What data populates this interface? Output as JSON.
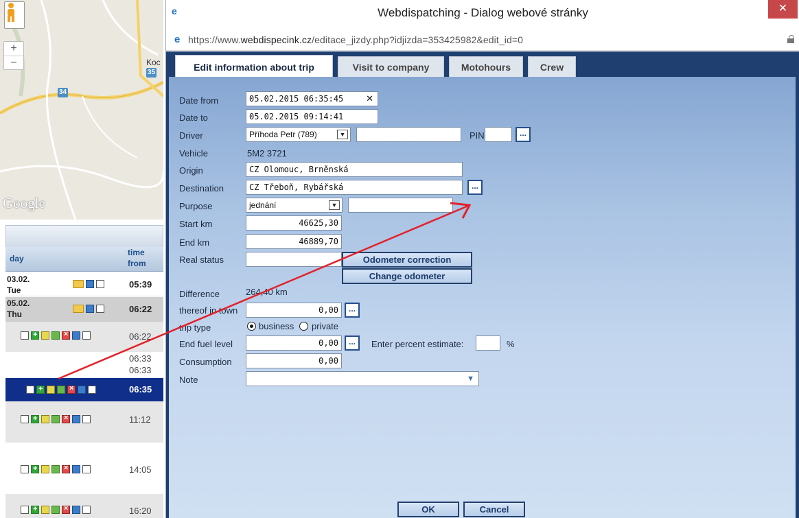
{
  "map": {
    "town_label": "Koc",
    "road_34": "34",
    "road_35": "35",
    "logo": "Google",
    "zoom_in": "+",
    "zoom_out": "−"
  },
  "day_list": {
    "col_day": "day",
    "col_time": "time from",
    "rows": [
      {
        "day": "03.02.",
        "weekday": "Tue",
        "time": "05:39"
      },
      {
        "day": "05.02.",
        "weekday": "Thu",
        "time": "06:22"
      },
      {
        "time": "06:22"
      },
      {
        "time": "06:33"
      },
      {
        "time": "06:33"
      },
      {
        "time": "06:35"
      },
      {
        "time": "11:12"
      },
      {
        "time": "14:05"
      },
      {
        "time": "16:20"
      }
    ]
  },
  "window": {
    "title": "Webdispatching - Dialog webové stránky",
    "close": "✕",
    "url_prefix": "https://www.",
    "url_domain": "webdispecink.cz",
    "url_rest": "/editace_jizdy.php?idjizda=353425982&edit_id=0"
  },
  "tabs": [
    {
      "label": "Edit information about trip",
      "active": true
    },
    {
      "label": "Visit to company",
      "active": false
    },
    {
      "label": "Motohours",
      "active": false
    },
    {
      "label": "Crew",
      "active": false
    }
  ],
  "form": {
    "date_from_label": "Date from",
    "date_from": "05.02.2015 06:35:45",
    "clear_icon": "✕",
    "date_to_label": "Date to",
    "date_to": "05.02.2015 09:14:41",
    "driver_label": "Driver",
    "driver": "Příhoda Petr (789)",
    "driver_extra": "",
    "pin_label": "PIN",
    "pin": "",
    "vehicle_label": "Vehicle",
    "vehicle": "5M2 3721",
    "origin_label": "Origin",
    "origin": "CZ Olomouc, Brněnská",
    "destination_label": "Destination",
    "destination": "CZ Třeboň, Rybářská",
    "purpose_label": "Purpose",
    "purpose": "jednání",
    "purpose_extra": "",
    "start_km_label": "Start km",
    "start_km": "46625,30",
    "end_km_label": "End km",
    "end_km": "46889,70",
    "real_status_label": "Real status",
    "real_status": "",
    "odometer_correction": "Odometer correction",
    "change_odometer": "Change odometer",
    "difference_label": "Difference",
    "difference": "264,40 km",
    "in_town_label": "thereof in town",
    "in_town": "0,00",
    "trip_type_label": "trip type",
    "trip_business": "business",
    "trip_private": "private",
    "fuel_label": "End fuel level",
    "fuel": "0,00",
    "percent_label": "Enter percent estimate:",
    "percent_value": "",
    "percent_unit": "%",
    "consumption_label": "Consumption",
    "consumption": "0,00",
    "note_label": "Note",
    "note": "",
    "dots": "...",
    "ok": "OK",
    "cancel": "Cancel"
  },
  "colors": {
    "dialog_frame": "#1f3f70",
    "panel_top": "#86a6d2",
    "panel_bottom": "#d0e0f3",
    "selected_row": "#0f2f8a",
    "close_button": "#c7484a",
    "annotation_arrow": "#e3212a"
  }
}
